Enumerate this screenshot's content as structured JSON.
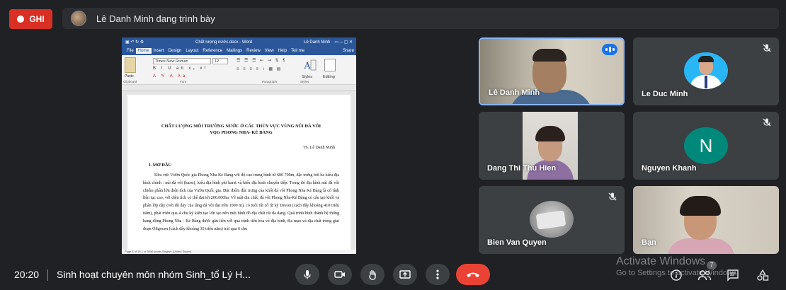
{
  "recording": {
    "label": "GHI"
  },
  "presentation_banner": {
    "text": "Lê Danh Minh đang trình bày"
  },
  "shared_screen": {
    "window_title": "Chất lượng nước.docx - Word",
    "window_user": "Lê Danh Minh",
    "ribbon_tabs": [
      "File",
      "Home",
      "Insert",
      "Design",
      "Layout",
      "Reference",
      "Mailings",
      "Review",
      "View",
      "Help",
      "Tell me",
      "Share"
    ],
    "font_name": "Times New Roman",
    "font_size": "12",
    "group_labels": [
      "Clipboard",
      "Font",
      "Paragraph",
      "Styles"
    ],
    "paste_label": "Paste",
    "styles_label": "Styles",
    "editing_label": "Editing",
    "doc_title": "CHẤT LƯỢNG MÔI TRƯỜNG NƯỚC Ở CÁC THỦY VỰC VÙNG NÚI ĐÁ VÔI VQG PHONG NHA- KẺ BÀNG",
    "doc_author": "TS. Lê Danh Minh",
    "doc_heading": "I.       MỞ ĐẦU",
    "doc_paragraph": "Khu vực Vườn Quốc gia Phong Nha Kẻ Bàng với độ cao trung bình từ 600 700m, đặc trưng bởi ba kiểu địa hình chính : núi đá vôi (karst), kiểu địa hình phi karst và kiểu địa hình chuyển tiếp. Trong đó địa hình núi đá vôi chiếm phần lớn diện tích của Vườn Quốc gia. Đặc điểm đặc trưng của khối đá vôi Phong Nha Kẻ Bàng là có tính liên tục cao, với diện tích có thể đạt tới 200.000ha. Về mặt địa chất, đá vôi Phong Nha-Kẻ Bàng có cấu tạo khối và phân lớp dày (với độ dày của tầng đá vôi đạt trên 1000 m), có tuổi rất cổ từ kỷ Devon (cách đây khoảng 410 triệu năm), phát triển qua 4 chu kỳ kiến tạo lớn tạo nên một bình đồ địa chất rất đa dạng. Quá trình hình thành hệ thống hang động Phong Nha - Kẻ Bàng được gắn liền với quá trình tiến hóa về địa hình, địa mạo và địa chất trong giai đoạn Oligocen (cách đây khoảng 35 triệu năm) trải qua 6 chu",
    "status_text": "Page 1 of 15    1 of 5056 words    English (United States)"
  },
  "participants": [
    {
      "name": "Lê Danh Minh",
      "state": "speaking"
    },
    {
      "name": "Le Duc Minh",
      "state": "muted"
    },
    {
      "name": "Dang Thi Thu Hien",
      "state": "video"
    },
    {
      "name": "Nguyen Khanh",
      "state": "muted",
      "initial": "N"
    },
    {
      "name": "Bien Van Quyen",
      "state": "muted"
    },
    {
      "name": "Bạn",
      "state": "self"
    }
  ],
  "bottom_bar": {
    "time": "20:20",
    "meeting_title": "Sinh hoạt chuyên môn nhóm Sinh_tổ Lý H...",
    "controls": [
      "mic-icon",
      "camera-icon",
      "raise-hand-icon",
      "present-icon",
      "more-options-icon",
      "end-call-icon"
    ],
    "people_count": "7"
  },
  "watermark": {
    "line1": "Activate Windows",
    "line2": "Go to Settings to activate Windows."
  },
  "colors": {
    "background": "#202124",
    "record_red": "#d93025",
    "hangup_red": "#ea4335",
    "active_border": "#8ab4f8",
    "word_blue": "#2b579a"
  }
}
